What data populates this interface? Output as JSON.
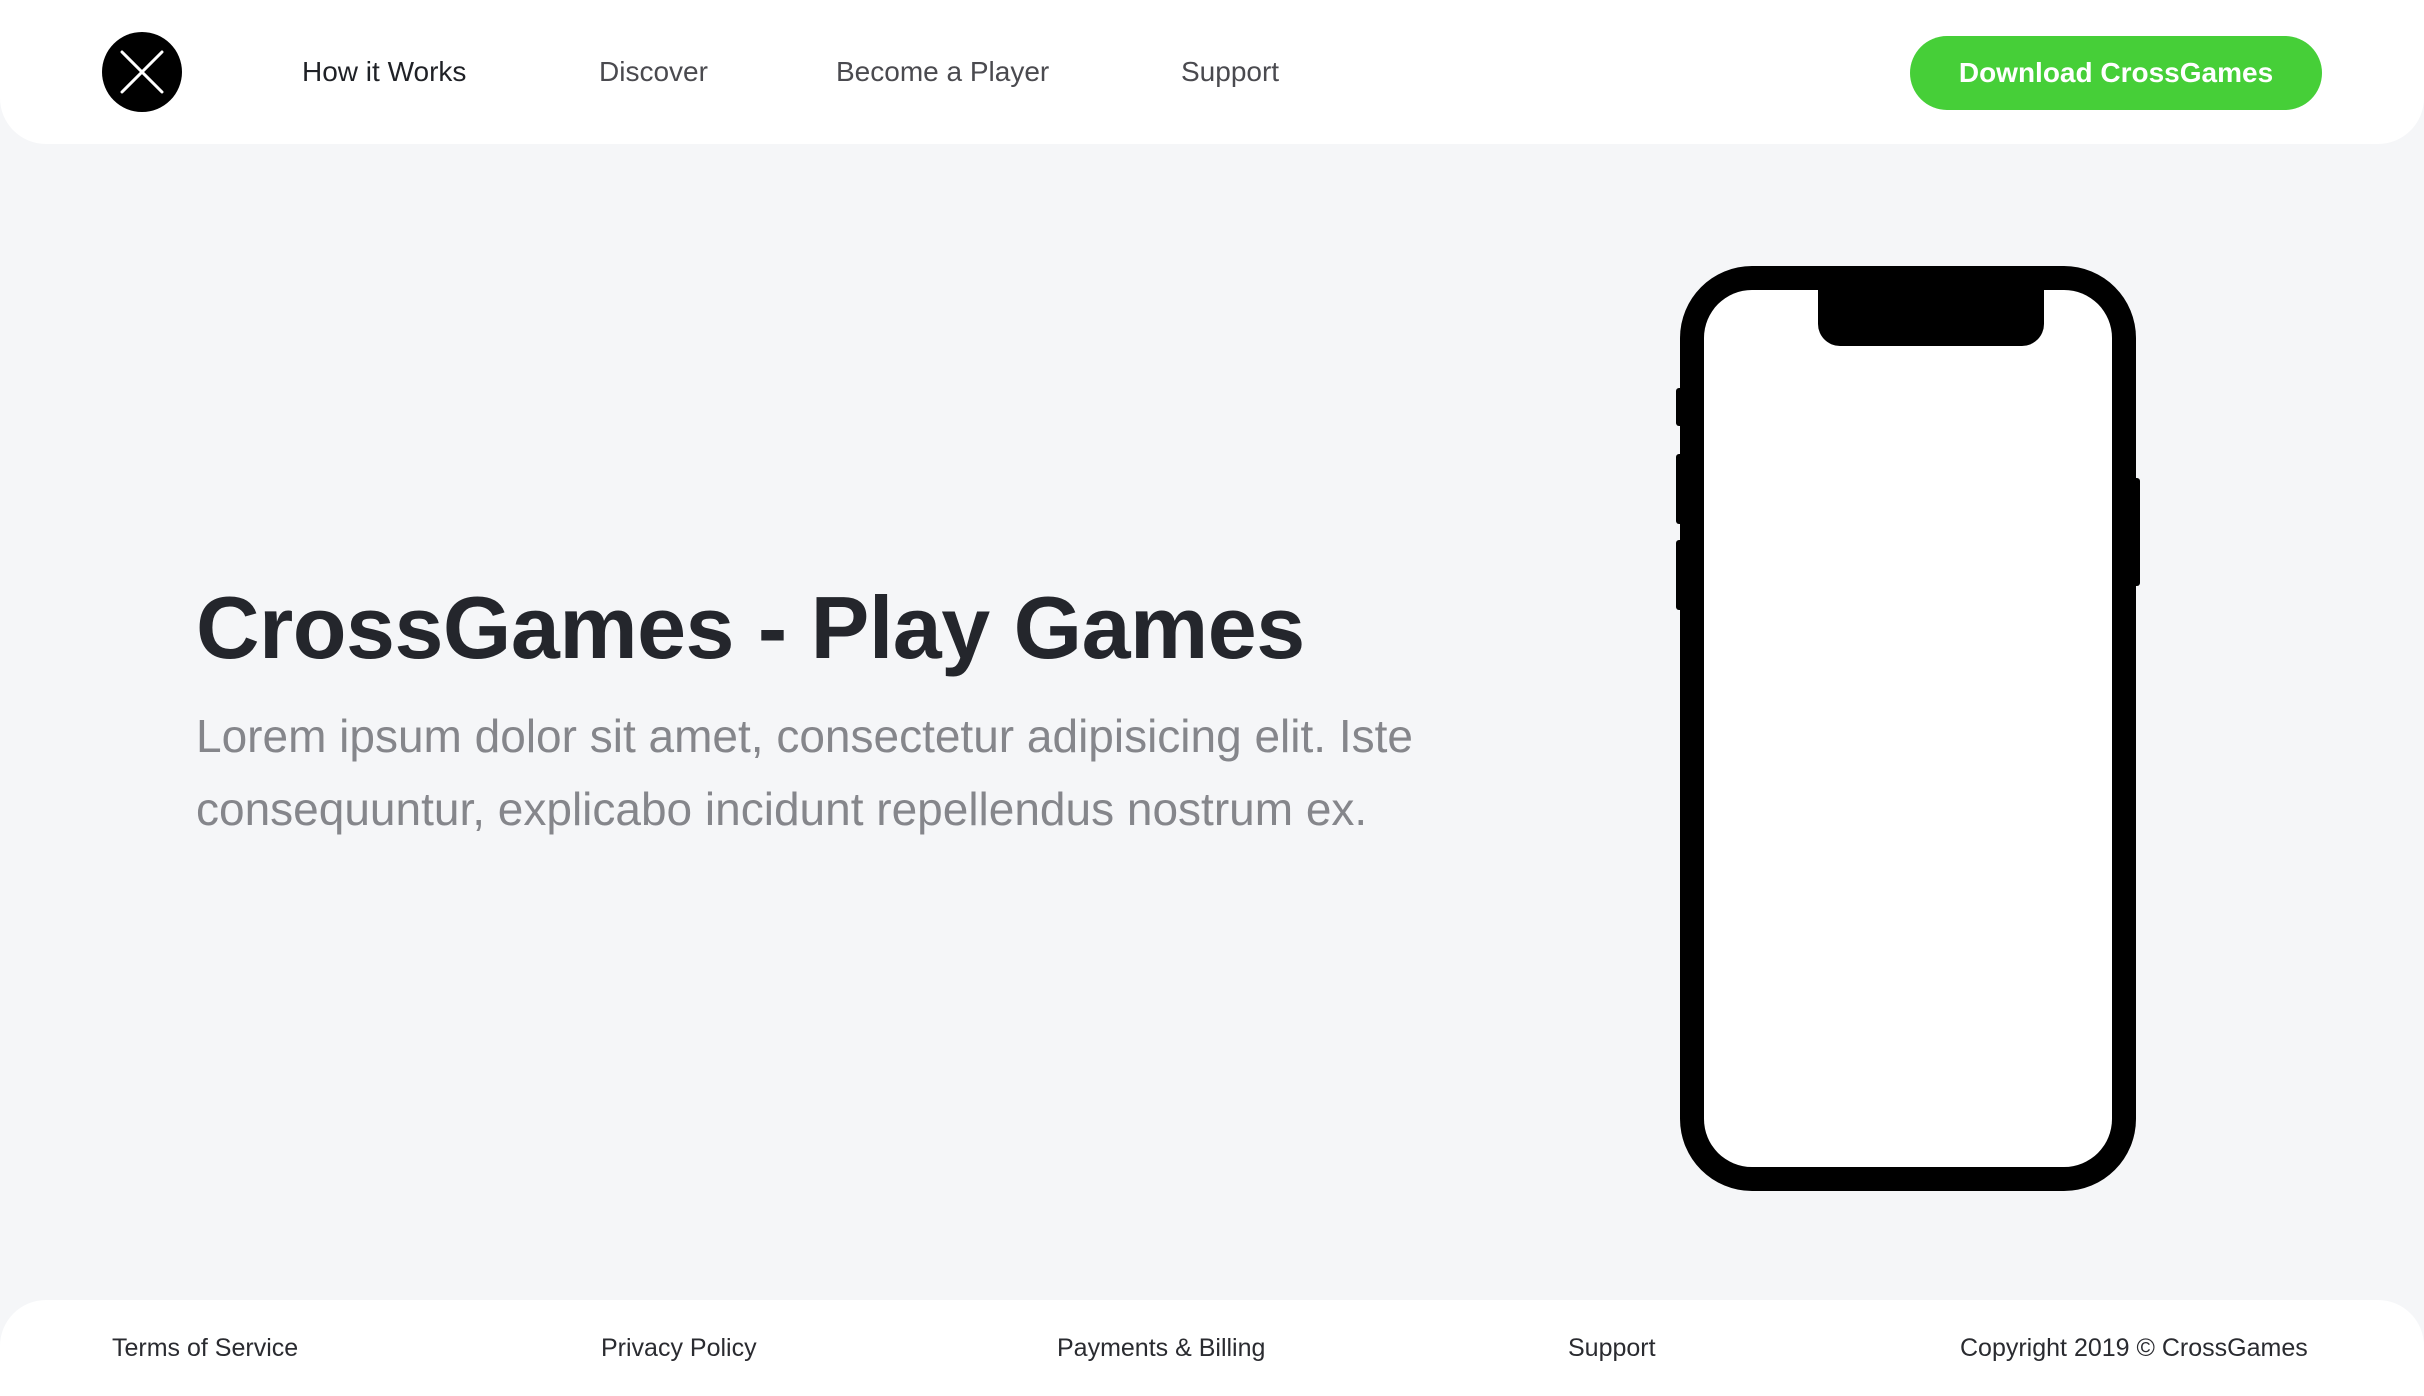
{
  "header": {
    "logo_icon": "crossed-x-logo-icon",
    "nav": [
      {
        "label": "How it Works"
      },
      {
        "label": "Discover"
      },
      {
        "label": "Become a Player"
      },
      {
        "label": "Support"
      }
    ],
    "download_button": "Download CrossGames"
  },
  "hero": {
    "title": "CrossGames - Play Games",
    "subtitle": "Lorem ipsum dolor sit amet, consectetur adipisicing elit. Iste consequuntur, explicabo incidunt repellendus nostrum ex."
  },
  "footer": {
    "links": [
      {
        "label": "Terms of Service"
      },
      {
        "label": "Privacy Policy"
      },
      {
        "label": "Payments & Billing"
      },
      {
        "label": "Support"
      }
    ],
    "copyright": "Copyright 2019 © CrossGames"
  },
  "colors": {
    "accent": "#46cf38",
    "background": "#f5f6f8",
    "heading": "#24262c",
    "muted_text": "#85868b"
  }
}
